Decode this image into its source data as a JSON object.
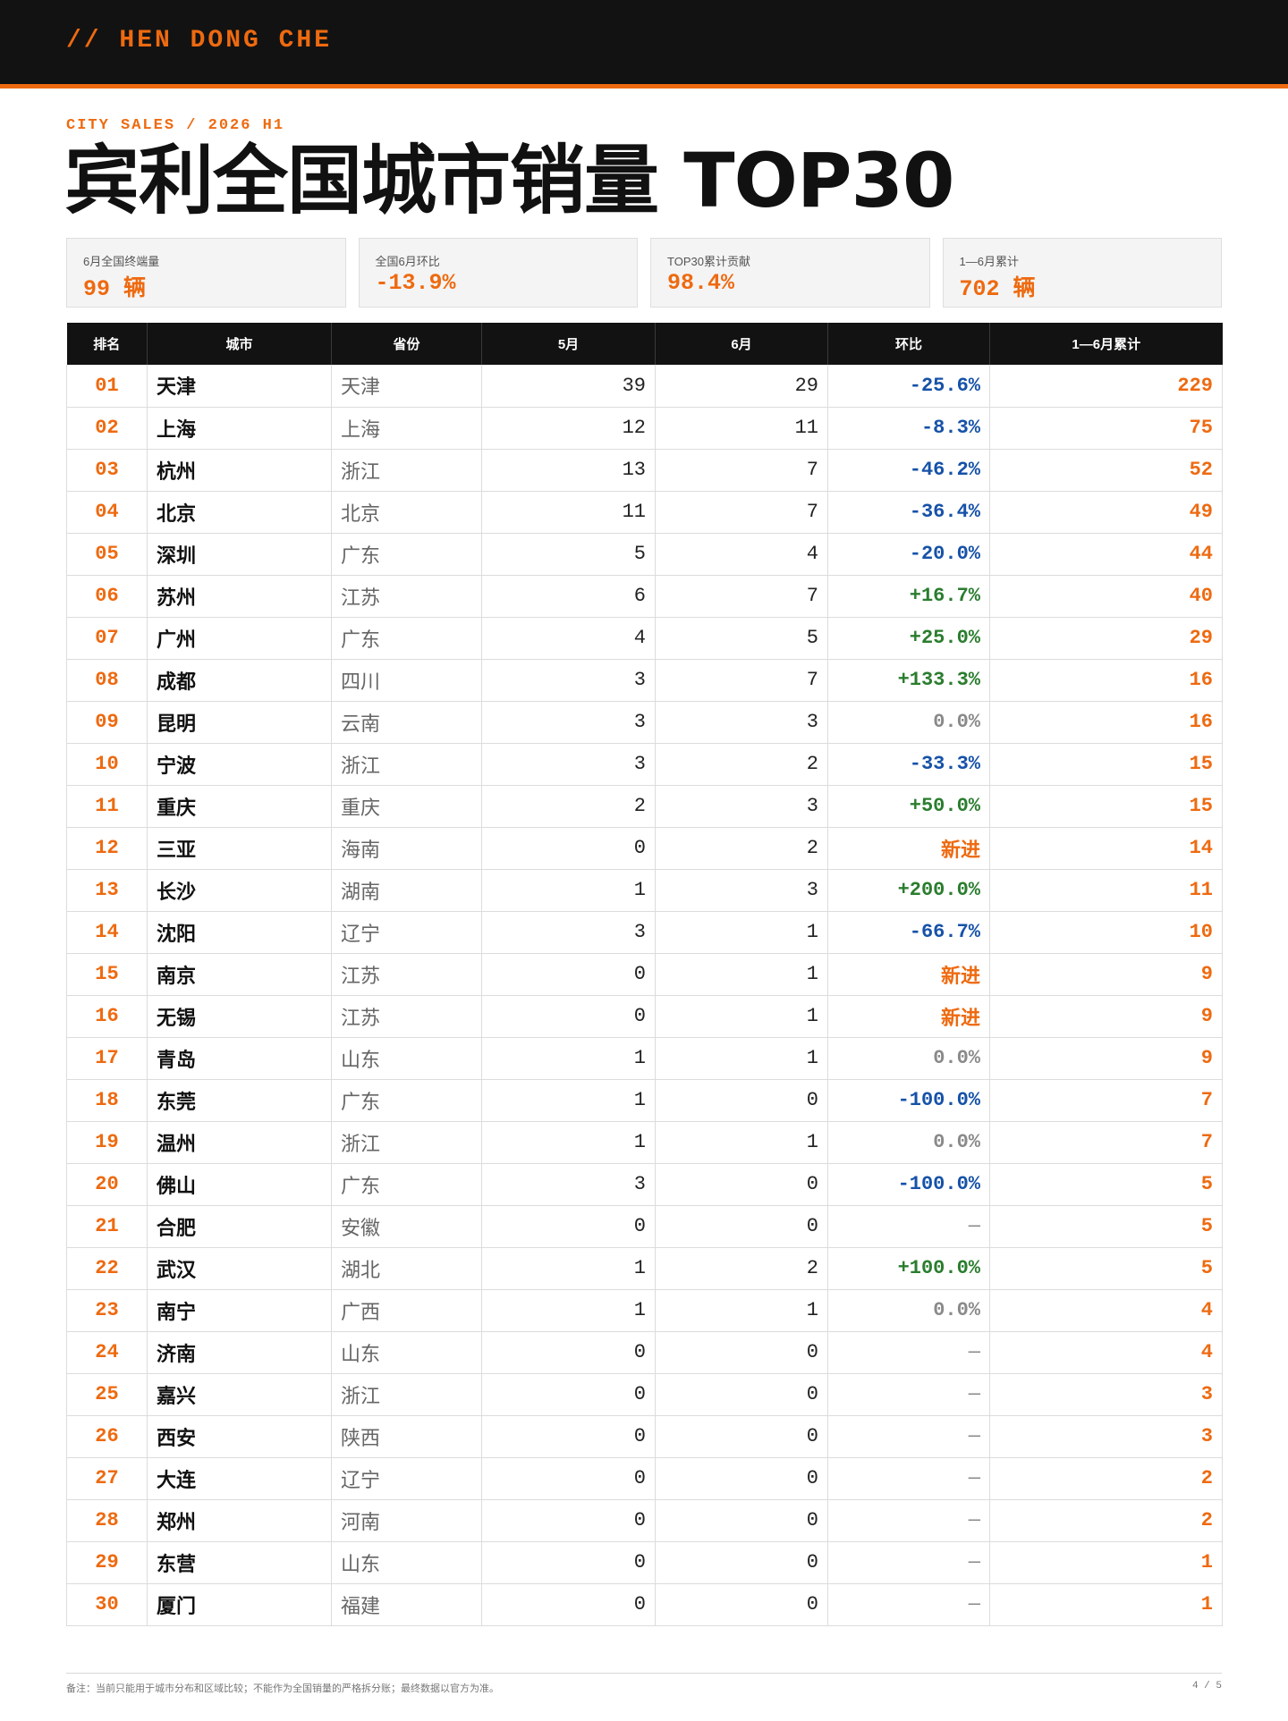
{
  "header": {
    "brand": "// HEN DONG CHE"
  },
  "eyebrow": "CITY SALES / 2026 H1",
  "title": "宾利全国城市销量 TOP30",
  "kpis": [
    {
      "label": "6月全国终端量",
      "value": "99 辆"
    },
    {
      "label": "全国6月环比",
      "value": "-13.9%"
    },
    {
      "label": "TOP30累计贡献",
      "value": "98.4%"
    },
    {
      "label": "1—6月累计",
      "value": "702 辆"
    }
  ],
  "table": {
    "headers": [
      "排名",
      "城市",
      "省份",
      "5月",
      "6月",
      "环比",
      "1—6月累计"
    ],
    "rows": [
      {
        "rank": "01",
        "city": "天津",
        "province": "天津",
        "may": "39",
        "jun": "29",
        "mom": "-25.6%",
        "trend": "neg",
        "total": "229"
      },
      {
        "rank": "02",
        "city": "上海",
        "province": "上海",
        "may": "12",
        "jun": "11",
        "mom": "-8.3%",
        "trend": "neg",
        "total": "75"
      },
      {
        "rank": "03",
        "city": "杭州",
        "province": "浙江",
        "may": "13",
        "jun": "7",
        "mom": "-46.2%",
        "trend": "neg",
        "total": "52"
      },
      {
        "rank": "04",
        "city": "北京",
        "province": "北京",
        "may": "11",
        "jun": "7",
        "mom": "-36.4%",
        "trend": "neg",
        "total": "49"
      },
      {
        "rank": "05",
        "city": "深圳",
        "province": "广东",
        "may": "5",
        "jun": "4",
        "mom": "-20.0%",
        "trend": "neg",
        "total": "44"
      },
      {
        "rank": "06",
        "city": "苏州",
        "province": "江苏",
        "may": "6",
        "jun": "7",
        "mom": "+16.7%",
        "trend": "pos",
        "total": "40"
      },
      {
        "rank": "07",
        "city": "广州",
        "province": "广东",
        "may": "4",
        "jun": "5",
        "mom": "+25.0%",
        "trend": "pos",
        "total": "29"
      },
      {
        "rank": "08",
        "city": "成都",
        "province": "四川",
        "may": "3",
        "jun": "7",
        "mom": "+133.3%",
        "trend": "pos",
        "total": "16"
      },
      {
        "rank": "09",
        "city": "昆明",
        "province": "云南",
        "may": "3",
        "jun": "3",
        "mom": "0.0%",
        "trend": "flat",
        "total": "16"
      },
      {
        "rank": "10",
        "city": "宁波",
        "province": "浙江",
        "may": "3",
        "jun": "2",
        "mom": "-33.3%",
        "trend": "neg",
        "total": "15"
      },
      {
        "rank": "11",
        "city": "重庆",
        "province": "重庆",
        "may": "2",
        "jun": "3",
        "mom": "+50.0%",
        "trend": "pos",
        "total": "15"
      },
      {
        "rank": "12",
        "city": "三亚",
        "province": "海南",
        "may": "0",
        "jun": "2",
        "mom": "新进",
        "trend": "new",
        "total": "14"
      },
      {
        "rank": "13",
        "city": "长沙",
        "province": "湖南",
        "may": "1",
        "jun": "3",
        "mom": "+200.0%",
        "trend": "pos",
        "total": "11"
      },
      {
        "rank": "14",
        "city": "沈阳",
        "province": "辽宁",
        "may": "3",
        "jun": "1",
        "mom": "-66.7%",
        "trend": "neg",
        "total": "10"
      },
      {
        "rank": "15",
        "city": "南京",
        "province": "江苏",
        "may": "0",
        "jun": "1",
        "mom": "新进",
        "trend": "new",
        "total": "9"
      },
      {
        "rank": "16",
        "city": "无锡",
        "province": "江苏",
        "may": "0",
        "jun": "1",
        "mom": "新进",
        "trend": "new",
        "total": "9"
      },
      {
        "rank": "17",
        "city": "青岛",
        "province": "山东",
        "may": "1",
        "jun": "1",
        "mom": "0.0%",
        "trend": "flat",
        "total": "9"
      },
      {
        "rank": "18",
        "city": "东莞",
        "province": "广东",
        "may": "1",
        "jun": "0",
        "mom": "-100.0%",
        "trend": "neg",
        "total": "7"
      },
      {
        "rank": "19",
        "city": "温州",
        "province": "浙江",
        "may": "1",
        "jun": "1",
        "mom": "0.0%",
        "trend": "flat",
        "total": "7"
      },
      {
        "rank": "20",
        "city": "佛山",
        "province": "广东",
        "may": "3",
        "jun": "0",
        "mom": "-100.0%",
        "trend": "neg",
        "total": "5"
      },
      {
        "rank": "21",
        "city": "合肥",
        "province": "安徽",
        "may": "0",
        "jun": "0",
        "mom": "—",
        "trend": "none",
        "total": "5"
      },
      {
        "rank": "22",
        "city": "武汉",
        "province": "湖北",
        "may": "1",
        "jun": "2",
        "mom": "+100.0%",
        "trend": "pos",
        "total": "5"
      },
      {
        "rank": "23",
        "city": "南宁",
        "province": "广西",
        "may": "1",
        "jun": "1",
        "mom": "0.0%",
        "trend": "flat",
        "total": "4"
      },
      {
        "rank": "24",
        "city": "济南",
        "province": "山东",
        "may": "0",
        "jun": "0",
        "mom": "—",
        "trend": "none",
        "total": "4"
      },
      {
        "rank": "25",
        "city": "嘉兴",
        "province": "浙江",
        "may": "0",
        "jun": "0",
        "mom": "—",
        "trend": "none",
        "total": "3"
      },
      {
        "rank": "26",
        "city": "西安",
        "province": "陕西",
        "may": "0",
        "jun": "0",
        "mom": "—",
        "trend": "none",
        "total": "3"
      },
      {
        "rank": "27",
        "city": "大连",
        "province": "辽宁",
        "may": "0",
        "jun": "0",
        "mom": "—",
        "trend": "none",
        "total": "2"
      },
      {
        "rank": "28",
        "city": "郑州",
        "province": "河南",
        "may": "0",
        "jun": "0",
        "mom": "—",
        "trend": "none",
        "total": "2"
      },
      {
        "rank": "29",
        "city": "东营",
        "province": "山东",
        "may": "0",
        "jun": "0",
        "mom": "—",
        "trend": "none",
        "total": "1"
      },
      {
        "rank": "30",
        "city": "厦门",
        "province": "福建",
        "may": "0",
        "jun": "0",
        "mom": "—",
        "trend": "none",
        "total": "1"
      }
    ]
  },
  "footer": {
    "note": "备注：当前只能用于城市分布和区域比较；不能作为全国销量的严格拆分账；最终数据以官方为准。",
    "page": "4 / 5"
  },
  "colors": {
    "accent": "#ee6a10",
    "header_bg": "#121212",
    "negative": "#1652a8",
    "positive": "#2a7d2e",
    "neutral": "#8a8a8a"
  }
}
